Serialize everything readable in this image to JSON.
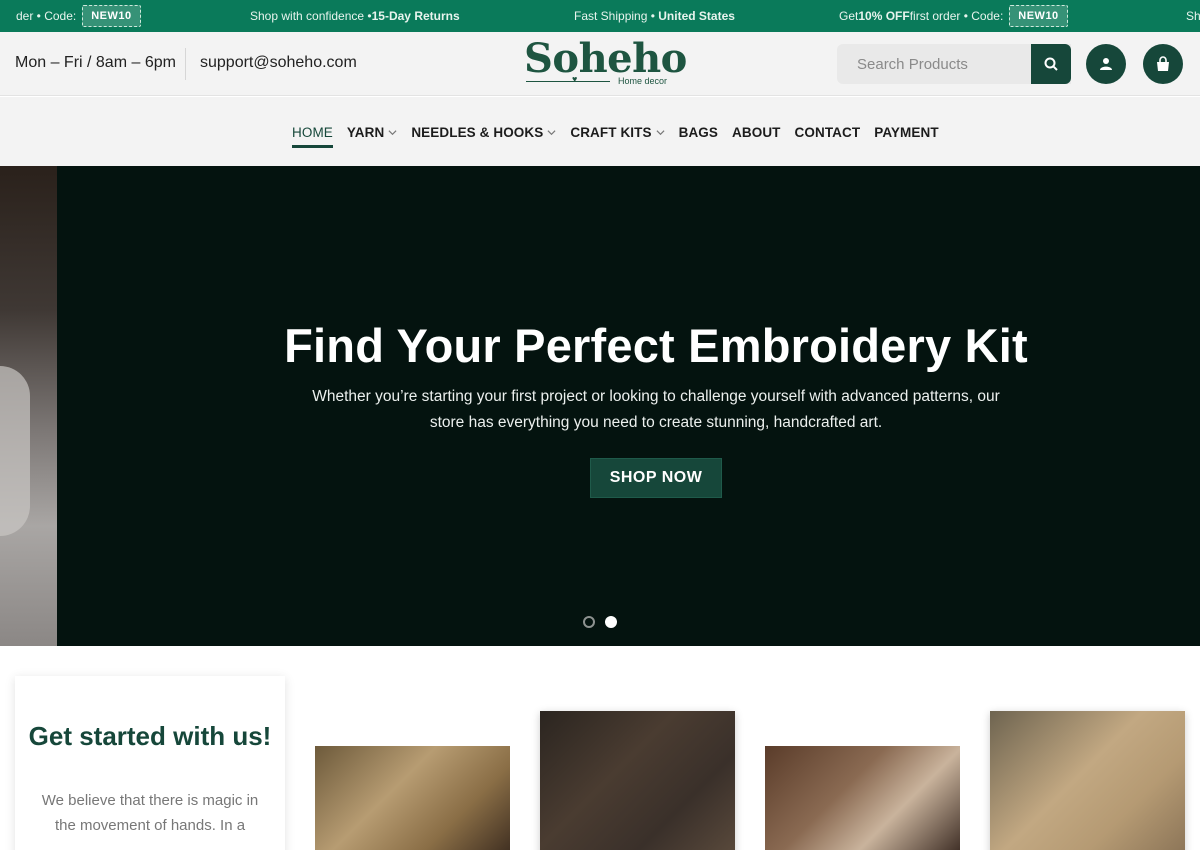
{
  "promo": {
    "seg1": {
      "text": "der • Code:",
      "code": "NEW10"
    },
    "seg2": {
      "text": "Shop with confidence •",
      "bold": "15-Day Returns"
    },
    "seg3": {
      "text": "Fast Shipping •",
      "bold": "United States"
    },
    "seg4": {
      "pre": "Get",
      "bold": "10% OFF",
      "post": "first order • Code:",
      "code": "NEW10"
    },
    "seg5": {
      "text": "Sh"
    }
  },
  "header": {
    "hours": "Mon – Fri / 8am – 6pm",
    "email": "support@soheho.com",
    "logo": {
      "name": "Soheho",
      "tagline": "Home decor"
    },
    "search_placeholder": "Search Products"
  },
  "nav": [
    {
      "label": "HOME",
      "active": true
    },
    {
      "label": "YARN",
      "dropdown": true
    },
    {
      "label": "NEEDLES & HOOKS",
      "dropdown": true
    },
    {
      "label": "CRAFT KITS",
      "dropdown": true
    },
    {
      "label": "BAGS"
    },
    {
      "label": "ABOUT"
    },
    {
      "label": "CONTACT"
    },
    {
      "label": "PAYMENT"
    }
  ],
  "hero": {
    "title": "Find Your Perfect Embroidery Kit",
    "text": "Whether you’re starting your first project or looking to challenge yourself with advanced patterns, our store has everything you need to create stunning, handcrafted art.",
    "button": "SHOP NOW"
  },
  "intro": {
    "title": "Get started with us!",
    "text": "We believe that there is magic in the movement of hands. In a"
  },
  "colors": {
    "accent": "#16473a",
    "promo_bar": "#0a7a5a",
    "hero_bg": "#04130f"
  }
}
